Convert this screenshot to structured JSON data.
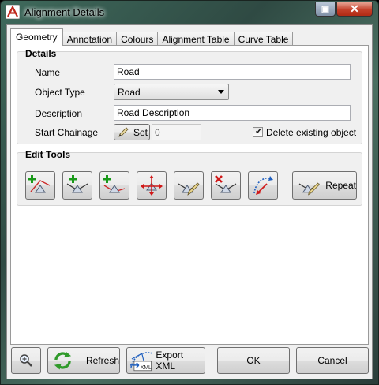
{
  "window": {
    "title": "Alignment Details",
    "restore_glyph": "▣",
    "close_glyph": "✕"
  },
  "tabs": [
    {
      "label": "Geometry",
      "active": true
    },
    {
      "label": "Annotation",
      "active": false
    },
    {
      "label": "Colours",
      "active": false
    },
    {
      "label": "Alignment Table",
      "active": false
    },
    {
      "label": "Curve Table",
      "active": false
    }
  ],
  "details": {
    "title": "Details",
    "name_label": "Name",
    "name_value": "Road",
    "object_type_label": "Object Type",
    "object_type_value": "Road",
    "description_label": "Description",
    "description_value": "Road Description",
    "start_chainage_label": "Start Chainage",
    "set_button_label": "Set",
    "chainage_value": "0",
    "delete_existing_label": "Delete existing object",
    "delete_existing_checked": true
  },
  "edit_tools": {
    "title": "Edit Tools",
    "repeat_label": "Repeat",
    "icons": [
      "add-ip-start-icon",
      "add-ip-middle-icon",
      "add-ip-end-icon",
      "move-ip-icon",
      "edit-ip-icon",
      "delete-ip-icon",
      "reverse-alignment-icon"
    ]
  },
  "footer": {
    "refresh_label": "Refresh",
    "export_xml_label": "Export XML",
    "ok_label": "OK",
    "cancel_label": "Cancel"
  },
  "colors": {
    "add_green": "#1a9a1a",
    "delete_red": "#d01818",
    "accent_blue": "#1f5fbf"
  }
}
